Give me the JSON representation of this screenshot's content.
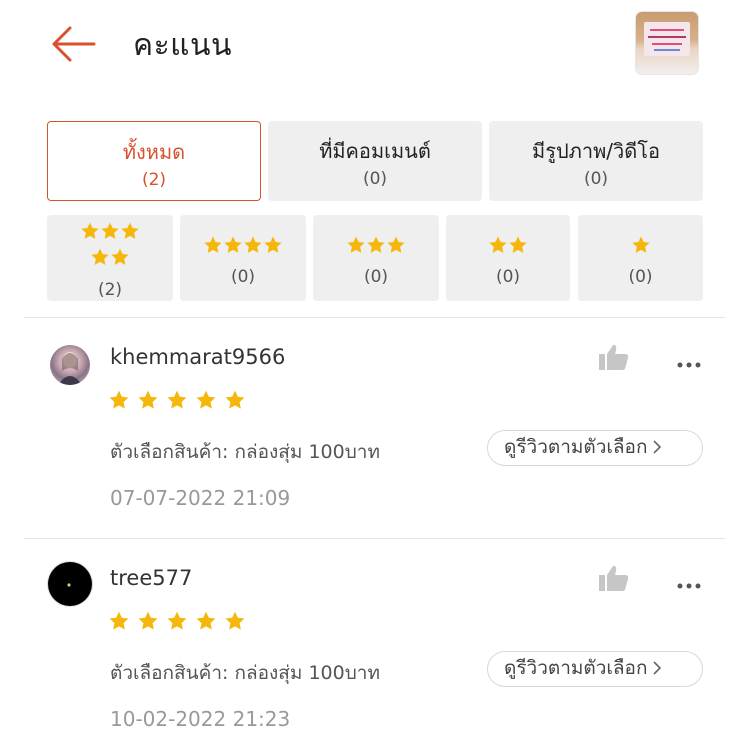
{
  "header": {
    "title": "คะแนน",
    "back_icon": "arrow-left-icon",
    "accent_color": "#d9512c"
  },
  "tabs": [
    {
      "label": "ทั้งหมด",
      "count": "(2)",
      "active": true
    },
    {
      "label": "ที่มีคอมเมนต์",
      "count": "(0)",
      "active": false
    },
    {
      "label": "มีรูปภาพ/วิดีโอ",
      "count": "(0)",
      "active": false
    }
  ],
  "star_filters": [
    {
      "stars": 5,
      "count": "(2)"
    },
    {
      "stars": 4,
      "count": "(0)"
    },
    {
      "stars": 3,
      "count": "(0)"
    },
    {
      "stars": 2,
      "count": "(0)"
    },
    {
      "stars": 1,
      "count": "(0)"
    }
  ],
  "star_color": "#f6b70d",
  "reviews": [
    {
      "username": "khemmarat9566",
      "rating": 5,
      "variation": "ตัวเลือกสินค้า: กล่องสุ่ม 100บาท",
      "view_variation_label": "ดูรีวิวตามตัวเลือก",
      "date": "07-07-2022 21:09"
    },
    {
      "username": "tree577",
      "rating": 5,
      "variation": "ตัวเลือกสินค้า: กล่องสุ่ม 100บาท",
      "view_variation_label": "ดูรีวิวตามตัวเลือก",
      "date": "10-02-2022 21:23"
    }
  ]
}
